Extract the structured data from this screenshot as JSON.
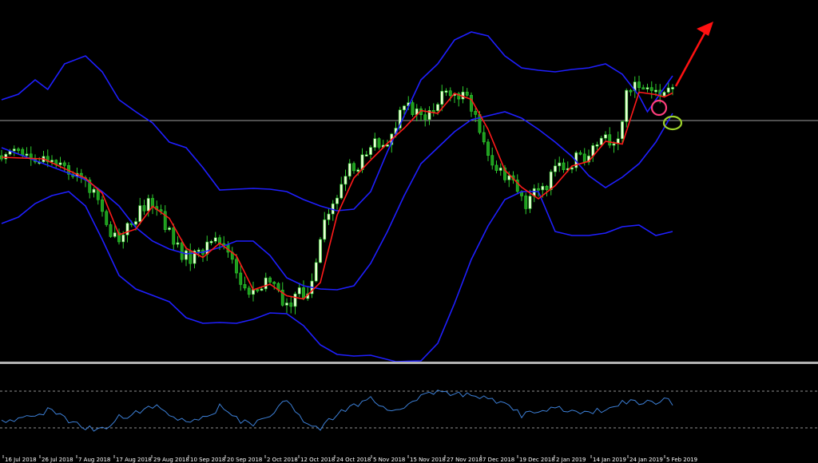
{
  "colors": {
    "background": "#000000",
    "candle": "#2ecc2e",
    "candle_up_fill": "#eaffd6",
    "candle_down_fill": "#1e9c1e",
    "bollinger": "#1f1fff",
    "moving_average": "#ff1a1a",
    "horizontal_line": "#9e9e9e",
    "separator": "#b4b4b4",
    "oscillator": "#3c7fd6",
    "oscillator_levels": "#bfbfbf",
    "axis_text": "#ffffff",
    "pink_circle": "#ff3e7b",
    "green_circle": "#9cd12c",
    "arrow": "#ff1111"
  },
  "chart_data": {
    "type": "line",
    "title": "",
    "x_tick_labels": [
      "16 Jul 2018",
      "26 Jul 2018",
      "7 Aug 2018",
      "17 Aug 2018",
      "29 Aug 2018",
      "10 Sep 2018",
      "20 Sep 2018",
      "2 Oct 2018",
      "12 Oct 2018",
      "24 Oct 2018",
      "5 Nov 2018",
      "15 Nov 2018",
      "27 Nov 2018",
      "7 Dec 2018",
      "19 Dec 2018",
      "2 Jan 2019",
      "14 Jan 2019",
      "24 Jan 2019",
      "5 Feb 2019"
    ],
    "price_trend": [
      [
        0,
        195
      ],
      [
        4,
        190
      ],
      [
        8,
        197
      ],
      [
        12,
        205
      ],
      [
        16,
        214
      ],
      [
        19,
        225
      ],
      [
        22,
        240
      ],
      [
        24,
        262
      ],
      [
        26,
        292
      ],
      [
        28,
        305
      ],
      [
        30,
        285
      ],
      [
        32,
        270
      ],
      [
        33,
        258
      ],
      [
        35,
        255
      ],
      [
        37,
        262
      ],
      [
        39,
        281
      ],
      [
        41,
        300
      ],
      [
        43,
        318
      ],
      [
        45,
        323
      ],
      [
        47,
        318
      ],
      [
        49,
        305
      ],
      [
        51,
        300
      ],
      [
        53,
        307
      ],
      [
        55,
        330
      ],
      [
        57,
        355
      ],
      [
        59,
        367
      ],
      [
        61,
        360
      ],
      [
        63,
        348
      ],
      [
        65,
        357
      ],
      [
        67,
        380
      ],
      [
        69,
        377
      ],
      [
        71,
        368
      ],
      [
        73,
        369
      ],
      [
        75,
        335
      ],
      [
        77,
        280
      ],
      [
        79,
        255
      ],
      [
        81,
        232
      ],
      [
        83,
        210
      ],
      [
        85,
        210
      ],
      [
        87,
        187
      ],
      [
        89,
        175
      ],
      [
        91,
        180
      ],
      [
        93,
        172
      ],
      [
        95,
        145
      ],
      [
        97,
        133
      ],
      [
        99,
        140
      ],
      [
        101,
        145
      ],
      [
        103,
        135
      ],
      [
        105,
        117
      ],
      [
        107,
        113
      ],
      [
        109,
        118
      ],
      [
        111,
        127
      ],
      [
        113,
        145
      ],
      [
        115,
        175
      ],
      [
        117,
        205
      ],
      [
        119,
        217
      ],
      [
        121,
        225
      ],
      [
        123,
        240
      ],
      [
        125,
        254
      ],
      [
        127,
        240
      ],
      [
        129,
        239
      ],
      [
        131,
        222
      ],
      [
        133,
        205
      ],
      [
        135,
        207
      ],
      [
        137,
        198
      ],
      [
        139,
        202
      ],
      [
        141,
        180
      ],
      [
        143,
        170
      ],
      [
        145,
        182
      ],
      [
        147,
        175
      ],
      [
        149,
        120
      ],
      [
        151,
        107
      ],
      [
        153,
        113
      ],
      [
        155,
        120
      ],
      [
        157,
        119
      ],
      [
        159,
        110
      ]
    ],
    "series": [
      {
        "values": [
          [
            0,
            185
          ],
          [
            10,
            205
          ],
          [
            20,
            225
          ],
          [
            24,
            240
          ],
          [
            28,
            258
          ],
          [
            32,
            285
          ],
          [
            36,
            302
          ],
          [
            40,
            312
          ],
          [
            44,
            318
          ],
          [
            48,
            316
          ],
          [
            52,
            310
          ],
          [
            56,
            302
          ],
          [
            60,
            302
          ],
          [
            64,
            320
          ],
          [
            68,
            348
          ],
          [
            72,
            358
          ],
          [
            76,
            362
          ],
          [
            80,
            363
          ],
          [
            84,
            358
          ],
          [
            88,
            330
          ],
          [
            92,
            290
          ],
          [
            96,
            245
          ],
          [
            100,
            205
          ],
          [
            104,
            185
          ],
          [
            108,
            165
          ],
          [
            112,
            150
          ],
          [
            116,
            145
          ],
          [
            120,
            140
          ],
          [
            124,
            148
          ],
          [
            128,
            162
          ],
          [
            132,
            178
          ],
          [
            136,
            196
          ],
          [
            140,
            220
          ],
          [
            144,
            235
          ],
          [
            148,
            222
          ],
          [
            152,
            205
          ],
          [
            156,
            178
          ],
          [
            158,
            160
          ],
          [
            160,
            142
          ]
        ]
      },
      {
        "values": [
          [
            0,
            125
          ],
          [
            4,
            118
          ],
          [
            8,
            100
          ],
          [
            11,
            112
          ],
          [
            15,
            80
          ],
          [
            20,
            70
          ],
          [
            24,
            90
          ],
          [
            28,
            125
          ],
          [
            32,
            140
          ],
          [
            36,
            154
          ],
          [
            40,
            178
          ],
          [
            44,
            185
          ],
          [
            48,
            210
          ],
          [
            52,
            238
          ],
          [
            56,
            237
          ],
          [
            60,
            236
          ],
          [
            64,
            237
          ],
          [
            68,
            240
          ],
          [
            72,
            250
          ],
          [
            76,
            258
          ],
          [
            80,
            264
          ],
          [
            84,
            262
          ],
          [
            88,
            240
          ],
          [
            92,
            190
          ],
          [
            96,
            145
          ],
          [
            100,
            100
          ],
          [
            104,
            80
          ],
          [
            108,
            50
          ],
          [
            112,
            40
          ],
          [
            116,
            45
          ],
          [
            120,
            70
          ],
          [
            124,
            85
          ],
          [
            128,
            88
          ],
          [
            132,
            90
          ],
          [
            136,
            87
          ],
          [
            140,
            85
          ],
          [
            144,
            80
          ],
          [
            148,
            93
          ],
          [
            152,
            120
          ],
          [
            154,
            140
          ],
          [
            156,
            125
          ],
          [
            158,
            110
          ],
          [
            160,
            95
          ]
        ]
      },
      {
        "values": [
          [
            0,
            280
          ],
          [
            4,
            272
          ],
          [
            8,
            255
          ],
          [
            12,
            245
          ],
          [
            16,
            240
          ],
          [
            20,
            258
          ],
          [
            24,
            300
          ],
          [
            28,
            345
          ],
          [
            32,
            362
          ],
          [
            36,
            370
          ],
          [
            40,
            378
          ],
          [
            44,
            398
          ],
          [
            48,
            405
          ],
          [
            52,
            404
          ],
          [
            56,
            405
          ],
          [
            60,
            400
          ],
          [
            64,
            392
          ],
          [
            68,
            393
          ],
          [
            72,
            408
          ],
          [
            76,
            432
          ],
          [
            80,
            444
          ],
          [
            84,
            446
          ],
          [
            88,
            445
          ],
          [
            94,
            453
          ],
          [
            100,
            452
          ],
          [
            104,
            430
          ],
          [
            108,
            380
          ],
          [
            112,
            325
          ],
          [
            116,
            283
          ],
          [
            120,
            250
          ],
          [
            124,
            240
          ],
          [
            128,
            240
          ],
          [
            132,
            290
          ],
          [
            136,
            295
          ],
          [
            140,
            295
          ],
          [
            144,
            292
          ],
          [
            148,
            284
          ],
          [
            152,
            282
          ],
          [
            156,
            295
          ],
          [
            160,
            290
          ]
        ]
      }
    ],
    "oscillator": {
      "levels": [
        490,
        536
      ],
      "values": [
        [
          0,
          530
        ],
        [
          8,
          520
        ],
        [
          12,
          512
        ],
        [
          16,
          526
        ],
        [
          20,
          535
        ],
        [
          24,
          538
        ],
        [
          28,
          522
        ],
        [
          32,
          518
        ],
        [
          36,
          508
        ],
        [
          40,
          520
        ],
        [
          44,
          530
        ],
        [
          48,
          525
        ],
        [
          52,
          510
        ],
        [
          56,
          525
        ],
        [
          60,
          533
        ],
        [
          64,
          521
        ],
        [
          68,
          500
        ],
        [
          72,
          528
        ],
        [
          76,
          535
        ],
        [
          80,
          520
        ],
        [
          84,
          508
        ],
        [
          88,
          500
        ],
        [
          92,
          514
        ],
        [
          96,
          510
        ],
        [
          100,
          498
        ],
        [
          104,
          490
        ],
        [
          108,
          495
        ],
        [
          112,
          495
        ],
        [
          116,
          500
        ],
        [
          120,
          508
        ],
        [
          124,
          520
        ],
        [
          128,
          518
        ],
        [
          132,
          510
        ],
        [
          136,
          515
        ],
        [
          140,
          518
        ],
        [
          144,
          512
        ],
        [
          148,
          504
        ],
        [
          152,
          505
        ],
        [
          156,
          505
        ],
        [
          158,
          500
        ],
        [
          160,
          505
        ]
      ]
    }
  },
  "annotations": {
    "arrow": {
      "label": ""
    },
    "circles": [
      "pink",
      "green"
    ]
  }
}
